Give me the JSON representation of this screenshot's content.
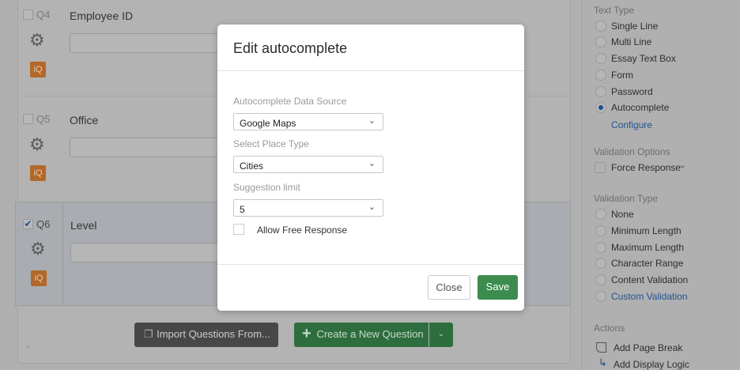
{
  "questions": [
    {
      "num": "Q4",
      "title": "Employee ID",
      "checked": false
    },
    {
      "num": "Q5",
      "title": "Office",
      "checked": false
    },
    {
      "num": "Q6",
      "title": "Level",
      "checked": true
    }
  ],
  "iq_label": "iQ",
  "bottom": {
    "import_label": "Import Questions From...",
    "create_label": "Create a New Question"
  },
  "sidebar": {
    "text_type_heading": "Text Type",
    "text_types": [
      "Single Line",
      "Multi Line",
      "Essay Text Box",
      "Form",
      "Password",
      "Autocomplete"
    ],
    "selected_text_type": "Autocomplete",
    "configure_label": "Configure",
    "validation_options_heading": "Validation Options",
    "force_response_label": "Force Response",
    "validation_type_heading": "Validation Type",
    "validation_types": [
      "None",
      "Minimum Length",
      "Maximum Length",
      "Character Range",
      "Content Validation",
      "Custom Validation"
    ],
    "actions_heading": "Actions",
    "actions": [
      "Add Page Break",
      "Add Display Logic"
    ]
  },
  "modal": {
    "title": "Edit autocomplete",
    "source_label": "Autocomplete Data Source",
    "source_value": "Google Maps",
    "place_label": "Select Place Type",
    "place_value": "Cities",
    "limit_label": "Suggestion limit",
    "limit_value": "5",
    "free_response_label": "Allow Free Response",
    "close_label": "Close",
    "save_label": "Save"
  },
  "colors": {
    "accent_green": "#3d8c4f",
    "link_blue": "#1f5390",
    "iq_orange": "#b2682a"
  }
}
